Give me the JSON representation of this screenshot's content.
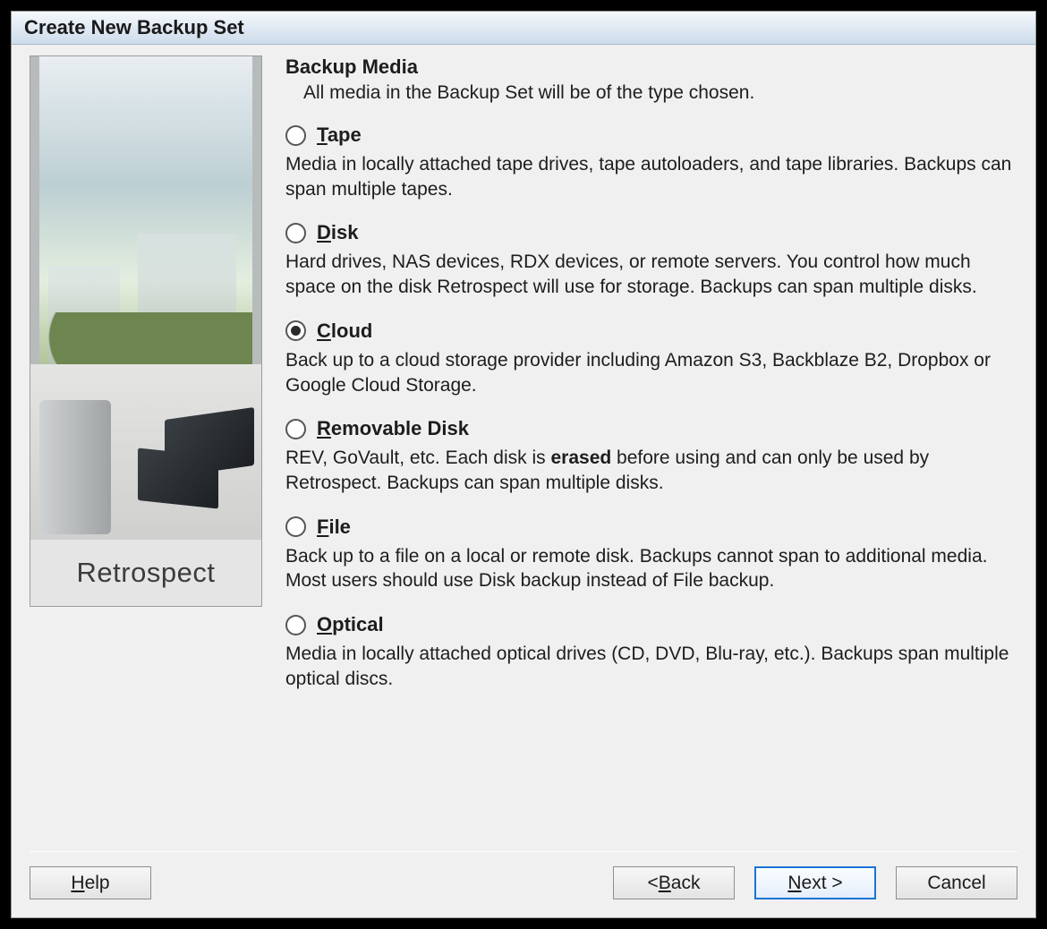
{
  "window": {
    "title": "Create New Backup Set"
  },
  "brand": "Retrospect",
  "heading": "Backup Media",
  "subtitle": "All media in the Backup Set will be of the type chosen.",
  "options": [
    {
      "id": "tape",
      "mnemonic": "T",
      "rest": "ape",
      "checked": false,
      "desc": "Media in locally attached tape drives, tape autoloaders, and tape libraries. Backups can span multiple tapes."
    },
    {
      "id": "disk",
      "mnemonic": "D",
      "rest": "isk",
      "checked": false,
      "desc": "Hard drives, NAS devices, RDX devices, or remote servers. You control how much space on the disk Retrospect will use for storage. Backups can span multiple disks."
    },
    {
      "id": "cloud",
      "mnemonic": "C",
      "rest": "loud",
      "checked": true,
      "desc": "Back up to a cloud storage provider including Amazon S3, Backblaze B2, Dropbox or Google Cloud Storage."
    },
    {
      "id": "removable",
      "mnemonic": "R",
      "rest": "emovable Disk",
      "checked": false,
      "desc_pre": "REV, GoVault, etc. Each disk is ",
      "desc_bold": "erased",
      "desc_post": " before using and can only be used by Retrospect. Backups can span multiple disks."
    },
    {
      "id": "file",
      "mnemonic": "F",
      "rest": "ile",
      "checked": false,
      "desc": "Back up to a file on a local or remote disk. Backups cannot span to additional media. Most users should use Disk backup instead of File backup."
    },
    {
      "id": "optical",
      "mnemonic": "O",
      "rest": "ptical",
      "checked": false,
      "desc": "Media in locally attached optical drives (CD, DVD, Blu-ray, etc.). Backups span multiple optical discs."
    }
  ],
  "buttons": {
    "help_mn": "H",
    "help_rest": "elp",
    "back_pre": "< ",
    "back_mn": "B",
    "back_rest": "ack",
    "next_mn": "N",
    "next_rest": "ext >",
    "cancel": "Cancel"
  }
}
